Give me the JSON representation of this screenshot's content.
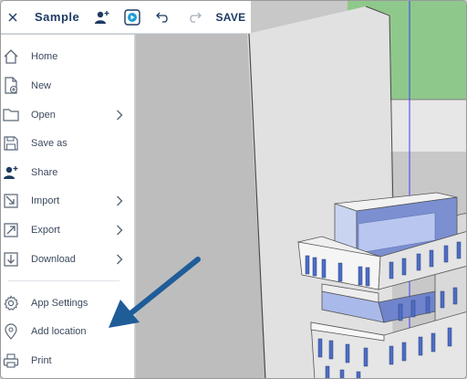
{
  "toolbar": {
    "title": "Sample",
    "save_label": "SAVE",
    "close_icon": "close-icon",
    "user_icon": "add-user-icon",
    "present_icon": "play-presentation-icon",
    "undo_icon": "undo-icon",
    "redo_icon": "redo-icon"
  },
  "menu": {
    "items": [
      {
        "label": "Home",
        "icon": "home-icon",
        "submenu": false
      },
      {
        "label": "New",
        "icon": "new-file-icon",
        "submenu": false
      },
      {
        "label": "Open",
        "icon": "folder-icon",
        "submenu": true
      },
      {
        "label": "Save as",
        "icon": "save-icon",
        "submenu": false
      },
      {
        "label": "Share",
        "icon": "share-user-icon",
        "submenu": false
      },
      {
        "label": "Import",
        "icon": "import-icon",
        "submenu": true
      },
      {
        "label": "Export",
        "icon": "export-icon",
        "submenu": true
      },
      {
        "label": "Download",
        "icon": "download-icon",
        "submenu": true
      },
      {
        "label": "App Settings",
        "icon": "gear-icon",
        "submenu": false
      },
      {
        "label": "Add location",
        "icon": "location-pin-icon",
        "submenu": false
      },
      {
        "label": "Print",
        "icon": "printer-icon",
        "submenu": false
      }
    ]
  },
  "colors": {
    "brand_navy": "#1d3a63",
    "menu_text": "#3c4a5e",
    "icon_gray": "#5a6678",
    "annotation_arrow": "#1f5d99",
    "sky_green": "#8fc88b",
    "ground_gray": "#c8c8c8"
  }
}
